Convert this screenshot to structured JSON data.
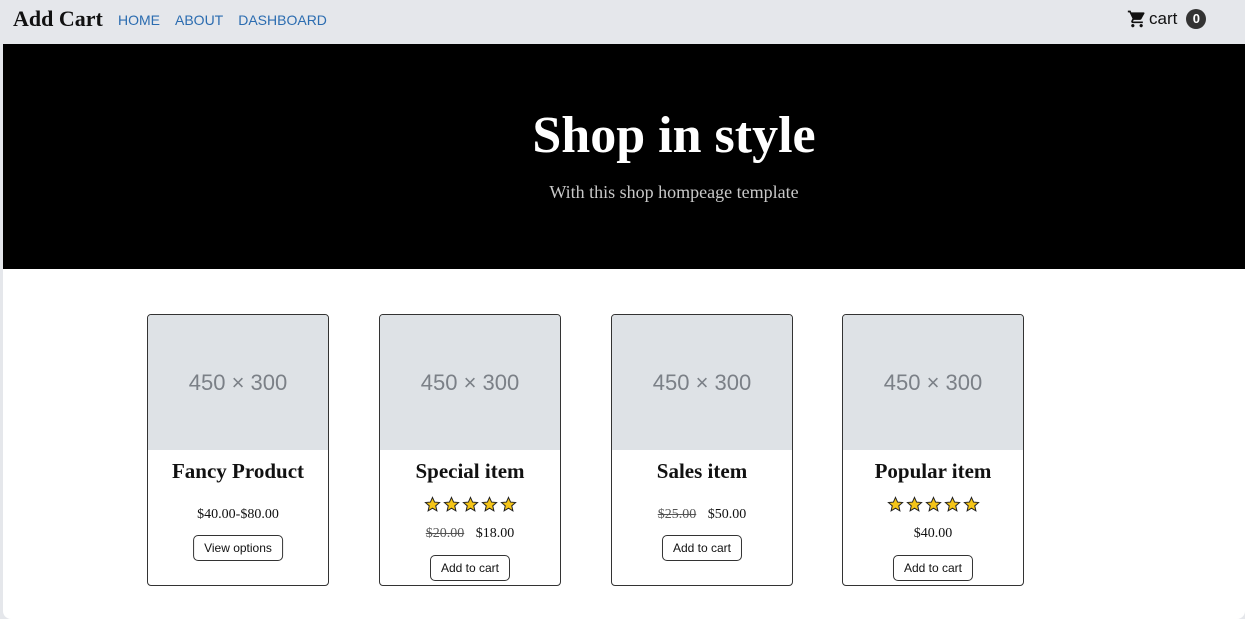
{
  "navbar": {
    "brand": "Add Cart",
    "links": [
      "HOME",
      "ABOUT",
      "DASHBOARD"
    ],
    "cart_label": "cart",
    "cart_count": "0"
  },
  "hero": {
    "title": "Shop in style",
    "subtitle": "With this shop hompeage template"
  },
  "products": [
    {
      "image_placeholder": "450 × 300",
      "name": "Fancy Product",
      "rating": 0,
      "old_price": "",
      "price": "$40.00-$80.00",
      "button": "View options"
    },
    {
      "image_placeholder": "450 × 300",
      "name": "Special item",
      "rating": 5,
      "old_price": "$20.00",
      "price": "$18.00",
      "button": "Add to cart"
    },
    {
      "image_placeholder": "450 × 300",
      "name": "Sales item",
      "rating": 0,
      "old_price": "$25.00",
      "price": "$50.00",
      "button": "Add to cart"
    },
    {
      "image_placeholder": "450 × 300",
      "name": "Popular item",
      "rating": 5,
      "old_price": "",
      "price": "$40.00",
      "button": "Add to cart"
    }
  ],
  "colors": {
    "link": "#2b6cb0",
    "hero_bg": "#000000",
    "star": "#f5c518"
  }
}
